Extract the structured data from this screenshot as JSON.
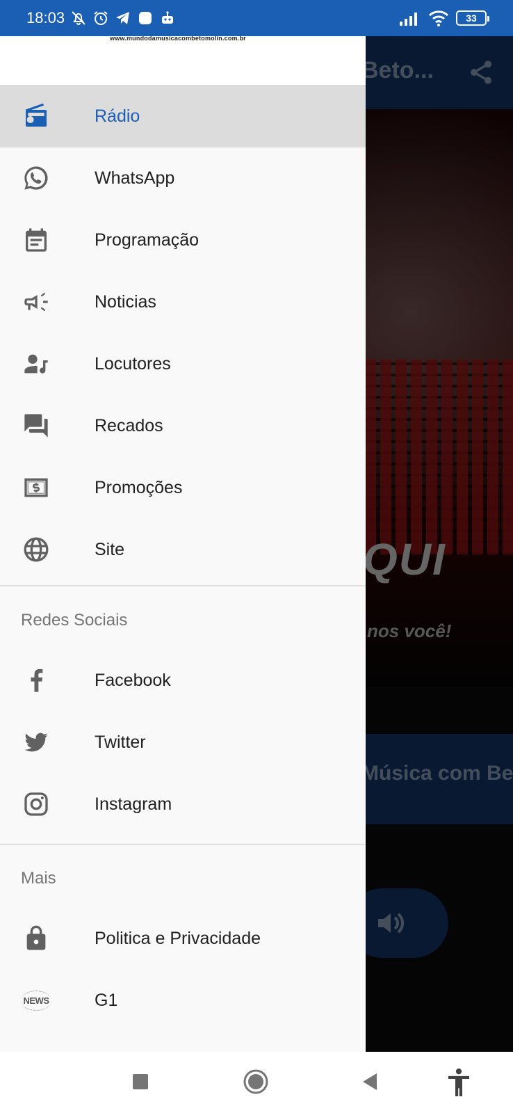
{
  "status_bar": {
    "time": "18:03",
    "battery": "33",
    "icons_left": [
      "bell-off-icon",
      "alarm-icon",
      "telegram-icon",
      "app-icon",
      "robot-icon"
    ],
    "icons_right": [
      "signal-icon",
      "wifi-icon",
      "battery-icon"
    ]
  },
  "background_app": {
    "toolbar_title": "Beto...",
    "hero_text": "QUI",
    "hero_subtext": "nos você!",
    "program_banner": "Música com Be"
  },
  "drawer": {
    "header_url": "www.mundodamusicacombetomolin.com.br",
    "main_items": [
      {
        "label": "Rádio",
        "icon": "radio-icon",
        "active": true
      },
      {
        "label": "WhatsApp",
        "icon": "whatsapp-icon",
        "active": false
      },
      {
        "label": "Programação",
        "icon": "calendar-icon",
        "active": false
      },
      {
        "label": "Noticias",
        "icon": "megaphone-icon",
        "active": false
      },
      {
        "label": "Locutores",
        "icon": "person-music-icon",
        "active": false
      },
      {
        "label": "Recados",
        "icon": "chat-icon",
        "active": false
      },
      {
        "label": "Promoções",
        "icon": "money-icon",
        "active": false
      },
      {
        "label": "Site",
        "icon": "globe-icon",
        "active": false
      }
    ],
    "social_header": "Redes Sociais",
    "social_items": [
      {
        "label": "Facebook",
        "icon": "facebook-icon"
      },
      {
        "label": "Twitter",
        "icon": "twitter-icon"
      },
      {
        "label": "Instagram",
        "icon": "instagram-icon"
      }
    ],
    "more_header": "Mais",
    "more_items": [
      {
        "label": "Politica e Privacidade",
        "icon": "lock-icon"
      },
      {
        "label": "G1",
        "icon": "news-icon",
        "icon_text": "NEWS"
      }
    ]
  },
  "nav_bar": {
    "buttons": [
      "recents-button",
      "home-button",
      "back-button",
      "accessibility-button"
    ]
  },
  "colors": {
    "accent": "#1a5fb4",
    "drawer_bg": "#f9f9f9",
    "active_item_bg": "#dcdcdc",
    "text_primary": "#212121",
    "text_secondary": "#757575"
  }
}
